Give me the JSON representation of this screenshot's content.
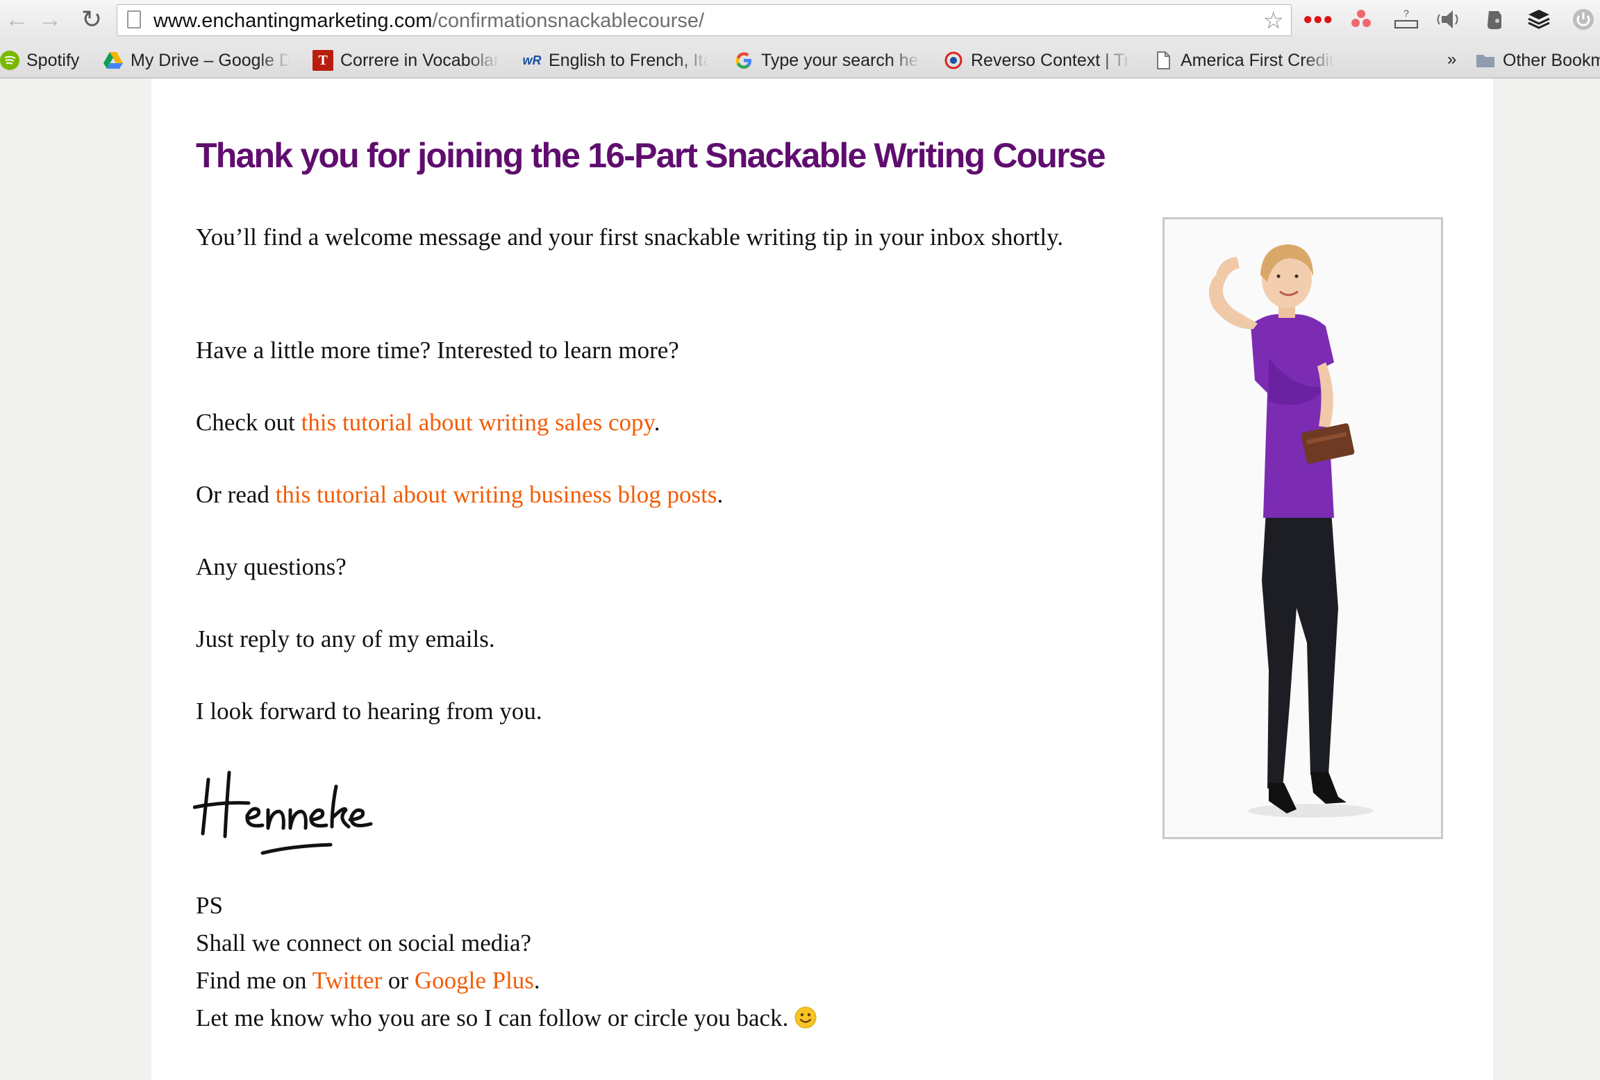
{
  "browser": {
    "url_host": "www.enchantingmarketing.com",
    "url_path": "/confirmationsnackablecourse/",
    "bookmarks": [
      {
        "label": "Spotify",
        "icon": "spotify-icon"
      },
      {
        "label": "My Drive – Google D",
        "icon": "google-drive-icon"
      },
      {
        "label": "Correre in Vocabolar",
        "icon": "treccani-icon"
      },
      {
        "label": "English to French, Ita",
        "icon": "wordreference-icon"
      },
      {
        "label": "Type your search her",
        "icon": "google-icon"
      },
      {
        "label": "Reverso Context | Tra",
        "icon": "reverso-icon"
      },
      {
        "label": "America First Credit",
        "icon": "page-icon"
      }
    ],
    "overflow_label": "»",
    "other_bookmarks": "Other Bookm"
  },
  "page": {
    "title": "Thank you for joining the 16-Part Snackable Writing Course",
    "p1": "You’ll find a welcome message and your first snackable writing tip in your inbox shortly.",
    "p2": "Have a little more time? Interested to learn more?",
    "p3_prefix": "Check out ",
    "p3_link": "this tutorial about writing sales copy",
    "p3_suffix": ".",
    "p4_prefix": "Or read ",
    "p4_link": "this tutorial about writing business blog posts",
    "p4_suffix": ".",
    "p5": "Any questions?",
    "p6": "Just reply to any of my emails.",
    "p7": "I look forward to hearing from you.",
    "signature": "Henneke",
    "ps_label": "PS",
    "ps_line1": "Shall we connect on social media?",
    "ps_line2_prefix": "Find me on ",
    "ps_twitter": "Twitter",
    "ps_line2_middle": " or ",
    "ps_google": "Google Plus",
    "ps_line2_suffix": ".",
    "ps_line3": "Let me know who you are so I can follow or circle you back."
  },
  "colors": {
    "heading": "#5f0d6e",
    "link": "#f25c05",
    "blouse": "#7b2cb3"
  }
}
